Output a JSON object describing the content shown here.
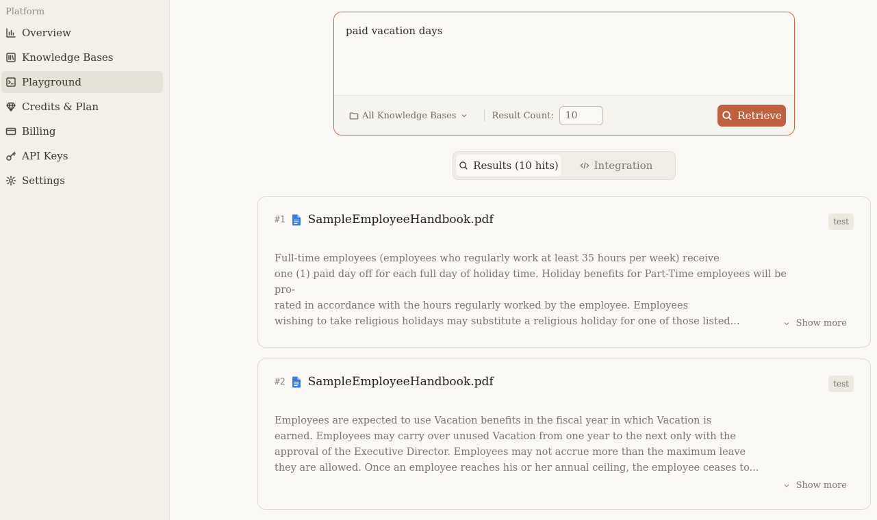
{
  "sidebar": {
    "section_label": "Platform",
    "items": [
      {
        "label": "Overview",
        "icon": "bar-chart-icon"
      },
      {
        "label": "Knowledge Bases",
        "icon": "library-icon"
      },
      {
        "label": "Playground",
        "icon": "terminal-icon",
        "active": true
      },
      {
        "label": "Credits & Plan",
        "icon": "gem-icon"
      },
      {
        "label": "Billing",
        "icon": "credit-card-icon"
      },
      {
        "label": "API Keys",
        "icon": "key-icon"
      },
      {
        "label": "Settings",
        "icon": "gear-icon"
      }
    ]
  },
  "query": {
    "text": "paid vacation days",
    "kb_select_label": "All Knowledge Bases",
    "result_count_label": "Result Count:",
    "result_count_value": "10",
    "retrieve_label": "Retrieve"
  },
  "tabs": {
    "results_label": "Results (10 hits)",
    "integration_label": "Integration"
  },
  "results": [
    {
      "rank": "#1",
      "file_name": "SampleEmployeeHandbook.pdf",
      "tag": "test",
      "snippet": "Full-time employees (employees who regularly work at least 35 hours per week) receive\none (1) paid day off for each full day of holiday time.  Holiday benefits for Part-Time employees will be pro-\nrated in accordance with the hours regularly worked by the employee.  Employees\nwishing to take religious holidays may substitute a religious holiday for one of those listed...",
      "show_more_label": "Show more"
    },
    {
      "rank": "#2",
      "file_name": "SampleEmployeeHandbook.pdf",
      "tag": "test",
      "snippet": "Employees are expected to use Vacation benefits in the fiscal year in which Vacation is\nearned.  Employees may carry over unused Vacation from one year to the next only with the\napproval of the Executive Director.  Employees may not accrue more than the maximum leave\nthey are allowed.  Once an employee reaches his or her annual ceiling, the employee ceases to...",
      "show_more_label": "Show more"
    }
  ],
  "colors": {
    "accent": "#c96442",
    "button": "#c0603f",
    "background": "#faf9f5",
    "sidebar": "#f2f0e9"
  }
}
